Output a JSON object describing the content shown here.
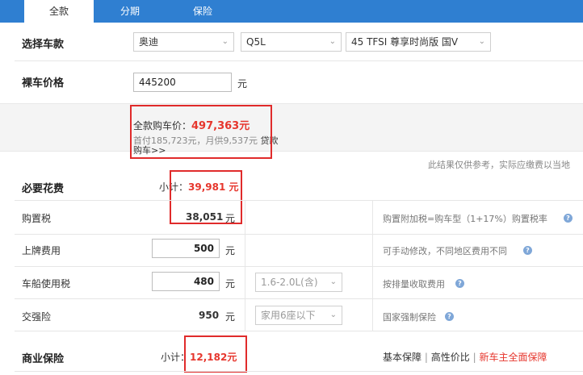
{
  "tabs": [
    {
      "label": "全款"
    },
    {
      "label": "分期"
    },
    {
      "label": "保险"
    }
  ],
  "select_car": {
    "label": "选择车款",
    "brand": "奥迪",
    "model": "Q5L",
    "trim": "45 TFSI 尊享时尚版 国V"
  },
  "bare_price": {
    "label": "裸车价格",
    "value": "445200",
    "unit": "元"
  },
  "summary": {
    "total_prefix": "全款购车价：",
    "total_value": "497,363元",
    "installment_text": "首付185,723元，月供9,537元",
    "loan_link": "贷款",
    "buy_link": "购车>>",
    "disclaimer": "此结果仅供参考，实际应缴费以当地"
  },
  "required": {
    "label": "必要花费",
    "subtotal_prefix": "小计：",
    "subtotal_value": "39,981 元",
    "rows": [
      {
        "name": "购置税",
        "value": "38,051",
        "unit": "元",
        "hint": "购置附加税=购车型（1+17%）购置税率"
      },
      {
        "name": "上牌费用",
        "value": "500",
        "unit": "元",
        "hint": "可手动修改，不同地区费用不同"
      },
      {
        "name": "车船使用税",
        "value": "480",
        "unit": "元",
        "option": "1.6-2.0L(含)",
        "hint": "按排量收取费用"
      },
      {
        "name": "交强险",
        "value": "950",
        "unit": "元",
        "option": "家用6座以下",
        "hint": "国家强制保险"
      }
    ]
  },
  "commercial": {
    "label": "商业保险",
    "subtotal_prefix": "小计：",
    "subtotal_value": "12,182元",
    "options": [
      "基本保障",
      "高性价比",
      "新车主全面保障"
    ],
    "separator": "|"
  },
  "colors": {
    "tab_bar": "#2f7fd1",
    "highlight_red": "#e6362d",
    "annotation_red": "#e02b2b"
  }
}
